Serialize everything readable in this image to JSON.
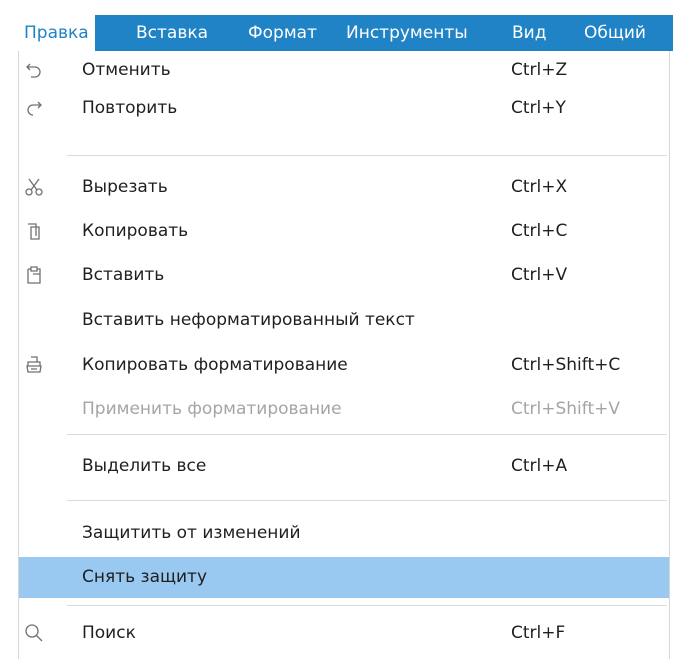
{
  "menubar": {
    "items": [
      "Правка",
      "Вставка",
      "Формат",
      "Инструменты",
      "Вид",
      "Общий"
    ]
  },
  "menu": {
    "items": [
      {
        "label": "Отменить",
        "shortcut": "Ctrl+Z",
        "icon": "undo-icon"
      },
      {
        "label": "Повторить",
        "shortcut": "Ctrl+Y",
        "icon": "redo-icon"
      },
      {
        "label": "Вырезать",
        "shortcut": "Ctrl+X",
        "icon": "cut-icon"
      },
      {
        "label": "Копировать",
        "shortcut": "Ctrl+C",
        "icon": "copy-icon"
      },
      {
        "label": "Вставить",
        "shortcut": "Ctrl+V",
        "icon": "paste-icon"
      },
      {
        "label": "Вставить неформатированный текст",
        "shortcut": ""
      },
      {
        "label": "Копировать форматирование",
        "shortcut": "Ctrl+Shift+C",
        "icon": "format-painter-icon"
      },
      {
        "label": "Применить форматирование",
        "shortcut": "Ctrl+Shift+V",
        "state": "disabled"
      },
      {
        "label": "Выделить все",
        "shortcut": "Ctrl+A"
      },
      {
        "label": "Защитить от изменений",
        "shortcut": ""
      },
      {
        "label": "Снять защиту",
        "shortcut": "",
        "state": "highlighted"
      },
      {
        "label": "Поиск",
        "shortcut": "Ctrl+F",
        "icon": "search-icon"
      }
    ]
  },
  "colors": {
    "menubar_bg": "#1f83c6",
    "highlight_bg": "#99c9f1",
    "disabled_text": "#a5a5a5"
  }
}
